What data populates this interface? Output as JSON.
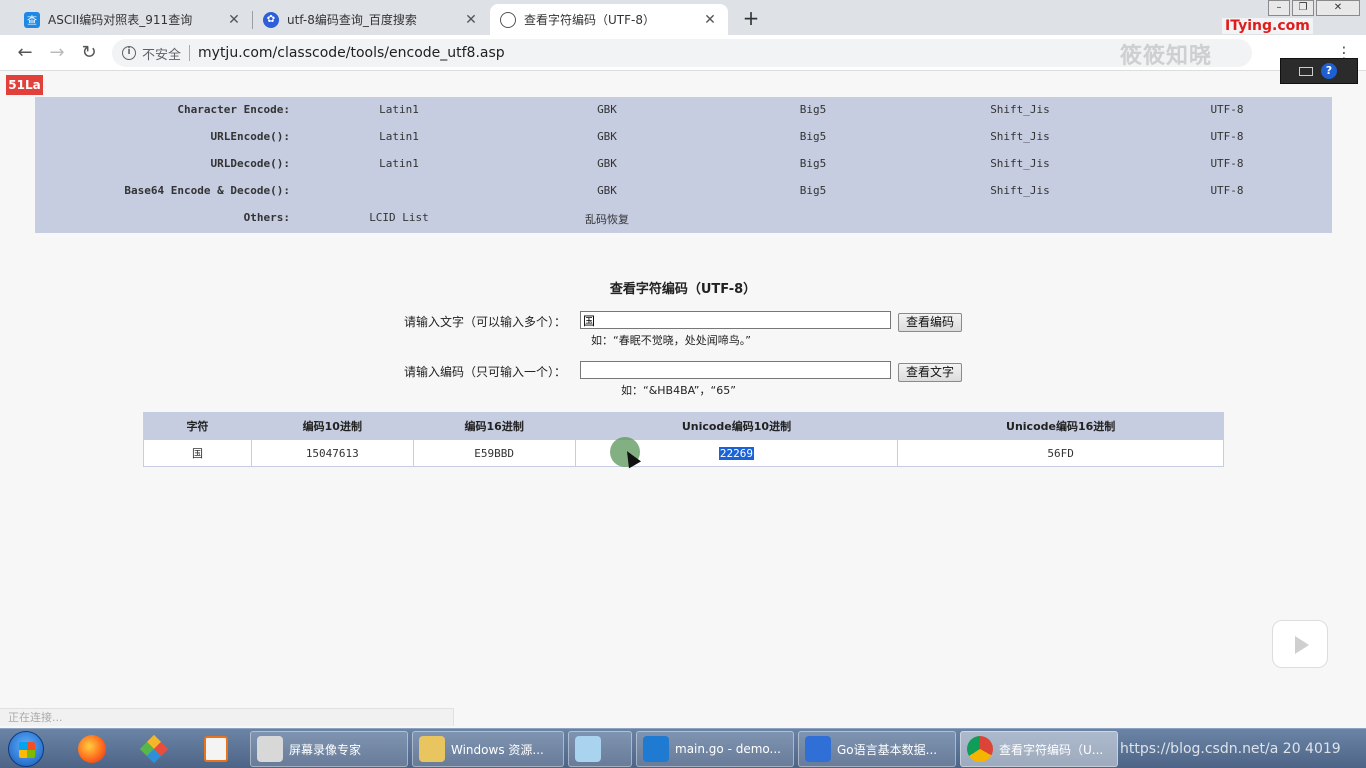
{
  "browser": {
    "tabs": [
      {
        "title": "ASCII编码对照表_911查询",
        "favicon": "911-icon",
        "color": "#1e88e5"
      },
      {
        "title": "utf-8编码查询_百度搜索",
        "favicon": "baidu-paw-icon",
        "color": "#2e5fd8"
      },
      {
        "title": "查看字符编码（UTF-8）",
        "favicon": "globe-icon",
        "color": "#555555"
      }
    ],
    "security_label": "不安全",
    "url": "mytju.com/classcode/tools/encode_utf8.asp"
  },
  "overlay": {
    "brand_watermark": "ITying.com",
    "cn_watermark": "筱筱知晓",
    "badge": "51La"
  },
  "encode_grid": {
    "rows": [
      {
        "label": "Character Encode:",
        "cells": [
          "Latin1",
          "GBK",
          "Big5",
          "Shift_Jis",
          "UTF-8"
        ]
      },
      {
        "label": "URLEncode():",
        "cells": [
          "Latin1",
          "GBK",
          "Big5",
          "Shift_Jis",
          "UTF-8"
        ]
      },
      {
        "label": "URLDecode():",
        "cells": [
          "Latin1",
          "GBK",
          "Big5",
          "Shift_Jis",
          "UTF-8"
        ]
      },
      {
        "label": "Base64 Encode & Decode():",
        "cells": [
          "",
          "GBK",
          "Big5",
          "Shift_Jis",
          "UTF-8"
        ]
      },
      {
        "label": "Others:",
        "cells": [
          "LCID List",
          "乱码恢复",
          "",
          "",
          ""
        ]
      }
    ]
  },
  "form": {
    "heading": "查看字符编码（UTF-8）",
    "text_label": "请输入文字（可以输入多个）：",
    "text_value": "国",
    "text_button": "查看编码",
    "text_hint": "如：“春眠不觉晓，处处闻啼鸟。”",
    "code_label": "请输入编码（只可输入一个）：",
    "code_value": "",
    "code_button": "查看文字",
    "code_hint": "如：“&HB4BA”，“65”"
  },
  "result": {
    "headers": [
      "字符",
      "编码10进制",
      "编码16进制",
      "Unicode编码10进制",
      "Unicode编码16进制"
    ],
    "row": [
      "国",
      "15047613",
      "E59BBD",
      "22269",
      "56FD"
    ]
  },
  "status_text": "正在连接...",
  "taskbar": {
    "tasks": [
      {
        "label": "屏幕录像专家"
      },
      {
        "label": "Windows 资源..."
      },
      {
        "label": ""
      },
      {
        "label": "main.go - demo..."
      },
      {
        "label": "Go语言基本数据..."
      },
      {
        "label": "查看字符编码（U..."
      }
    ],
    "tray_text": "https://blog.csdn.net/a    20 4019"
  }
}
